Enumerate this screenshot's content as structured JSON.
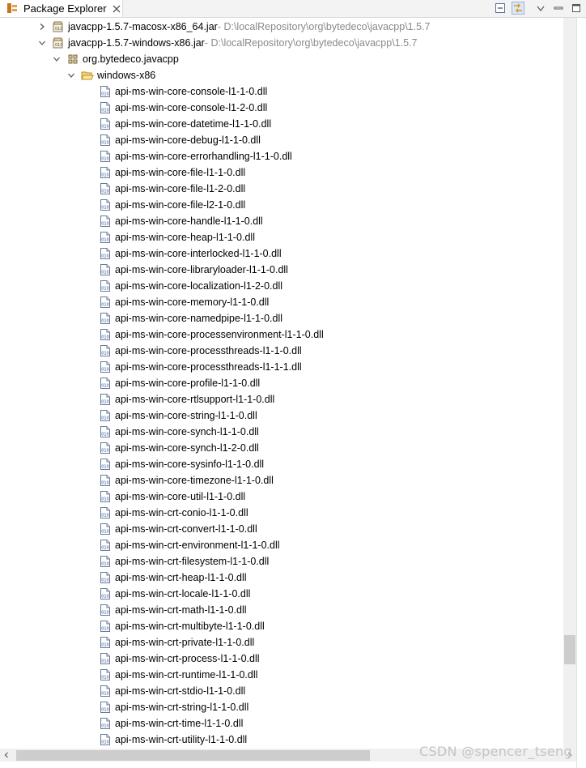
{
  "view": {
    "title": "Package Explorer"
  },
  "tree": {
    "jar_macos": {
      "name": "javacpp-1.5.7-macosx-x86_64.jar",
      "path": " - D:\\localRepository\\org\\bytedeco\\javacpp\\1.5.7"
    },
    "jar_windows": {
      "name": "javacpp-1.5.7-windows-x86.jar",
      "path": " - D:\\localRepository\\org\\bytedeco\\javacpp\\1.5.7"
    },
    "package": "org.bytedeco.javacpp",
    "folder": "windows-x86",
    "files": [
      "api-ms-win-core-console-l1-1-0.dll",
      "api-ms-win-core-console-l1-2-0.dll",
      "api-ms-win-core-datetime-l1-1-0.dll",
      "api-ms-win-core-debug-l1-1-0.dll",
      "api-ms-win-core-errorhandling-l1-1-0.dll",
      "api-ms-win-core-file-l1-1-0.dll",
      "api-ms-win-core-file-l1-2-0.dll",
      "api-ms-win-core-file-l2-1-0.dll",
      "api-ms-win-core-handle-l1-1-0.dll",
      "api-ms-win-core-heap-l1-1-0.dll",
      "api-ms-win-core-interlocked-l1-1-0.dll",
      "api-ms-win-core-libraryloader-l1-1-0.dll",
      "api-ms-win-core-localization-l1-2-0.dll",
      "api-ms-win-core-memory-l1-1-0.dll",
      "api-ms-win-core-namedpipe-l1-1-0.dll",
      "api-ms-win-core-processenvironment-l1-1-0.dll",
      "api-ms-win-core-processthreads-l1-1-0.dll",
      "api-ms-win-core-processthreads-l1-1-1.dll",
      "api-ms-win-core-profile-l1-1-0.dll",
      "api-ms-win-core-rtlsupport-l1-1-0.dll",
      "api-ms-win-core-string-l1-1-0.dll",
      "api-ms-win-core-synch-l1-1-0.dll",
      "api-ms-win-core-synch-l1-2-0.dll",
      "api-ms-win-core-sysinfo-l1-1-0.dll",
      "api-ms-win-core-timezone-l1-1-0.dll",
      "api-ms-win-core-util-l1-1-0.dll",
      "api-ms-win-crt-conio-l1-1-0.dll",
      "api-ms-win-crt-convert-l1-1-0.dll",
      "api-ms-win-crt-environment-l1-1-0.dll",
      "api-ms-win-crt-filesystem-l1-1-0.dll",
      "api-ms-win-crt-heap-l1-1-0.dll",
      "api-ms-win-crt-locale-l1-1-0.dll",
      "api-ms-win-crt-math-l1-1-0.dll",
      "api-ms-win-crt-multibyte-l1-1-0.dll",
      "api-ms-win-crt-private-l1-1-0.dll",
      "api-ms-win-crt-process-l1-1-0.dll",
      "api-ms-win-crt-runtime-l1-1-0.dll",
      "api-ms-win-crt-stdio-l1-1-0.dll",
      "api-ms-win-crt-string-l1-1-0.dll",
      "api-ms-win-crt-time-l1-1-0.dll",
      "api-ms-win-crt-utility-l1-1-0.dll"
    ]
  },
  "icons": {
    "view": "package-explorer-icon",
    "close": "close-icon",
    "collapse_all": "collapse-all-icon",
    "link_editor": "link-with-editor-icon",
    "view_menu": "view-menu-icon",
    "minimize": "minimize-icon",
    "maximize": "maximize-icon",
    "jar": "jar-icon",
    "package": "package-icon",
    "folder": "open-folder-icon",
    "file": "binary-file-icon"
  },
  "watermark": "CSDN @spencer_tseng"
}
